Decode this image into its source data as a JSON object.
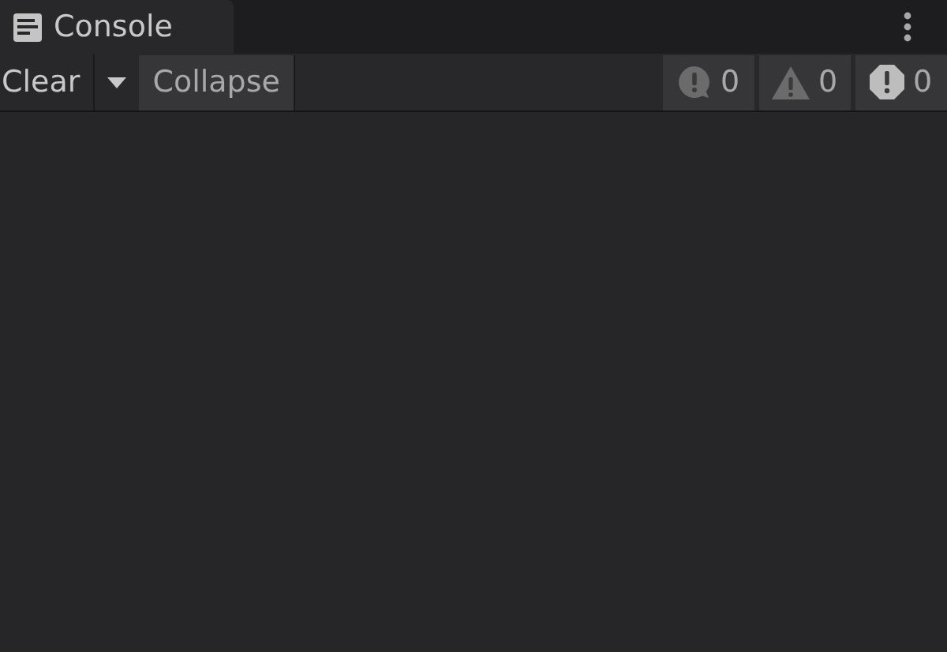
{
  "tab": {
    "title": "Console"
  },
  "toolbar": {
    "clear": "Clear",
    "collapse": "Collapse"
  },
  "counters": [
    {
      "kind": "info",
      "count": "0"
    },
    {
      "kind": "warning",
      "count": "0"
    },
    {
      "kind": "error",
      "count": "0"
    }
  ]
}
